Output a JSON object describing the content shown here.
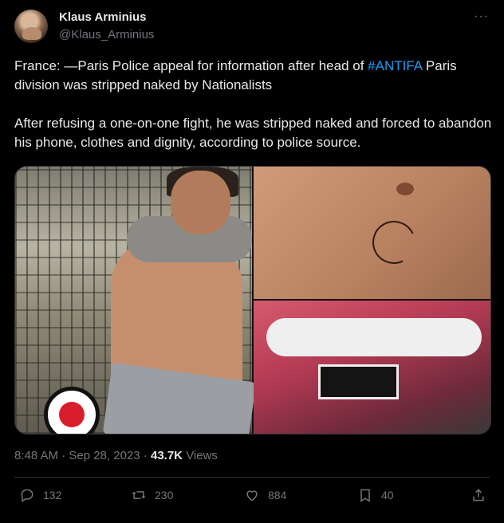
{
  "author": {
    "name": "Klaus Arminius",
    "handle": "@Klaus_Arminius",
    "avatar_icon": "avatar"
  },
  "more_icon": "more-icon",
  "tweet": {
    "text_part1": "France: —Paris Police appeal for information after head of ",
    "hashtag": "#ANTIFA",
    "text_part2": " Paris division was stripped naked by Nationalists\n\nAfter refusing a one-on-one fight, he was stripped naked and forced to abandon his phone, clothes and dignity, according to police source."
  },
  "meta": {
    "time": "8:48 AM",
    "separator": "·",
    "date": "Sep 28, 2023",
    "views_count": "43.7K",
    "views_label": "Views"
  },
  "actions": {
    "replies": "132",
    "reposts": "230",
    "likes": "884",
    "bookmarks": "40"
  },
  "colors": {
    "accent": "#1d9bf0",
    "secondary_text": "#71767b",
    "primary_text": "#e7e9ea",
    "background": "#000000",
    "divider": "#2f3336"
  }
}
